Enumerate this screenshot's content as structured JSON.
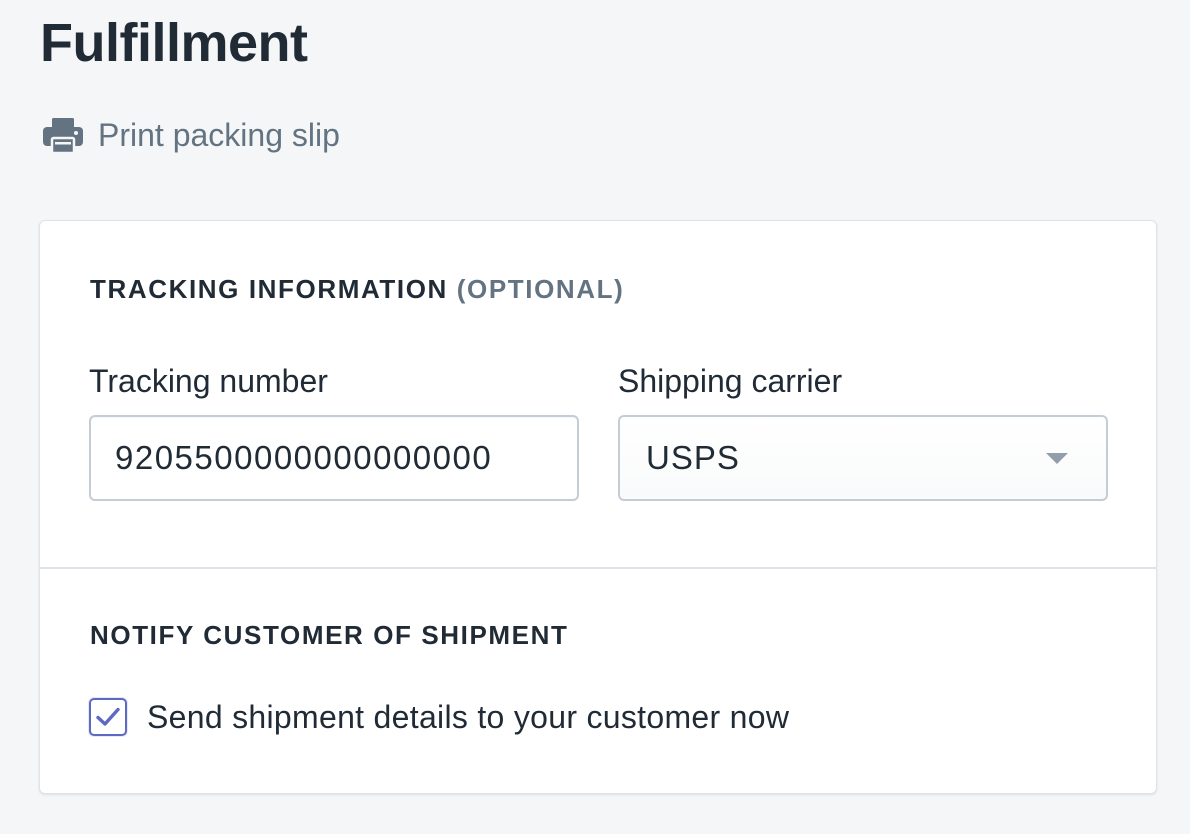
{
  "header": {
    "title": "Fulfillment",
    "print_label": "Print packing slip",
    "print_icon": "printer-icon"
  },
  "tracking": {
    "heading": "TRACKING INFORMATION",
    "heading_optional": "(OPTIONAL)",
    "number_label": "Tracking number",
    "number_value": "9205500000000000000",
    "carrier_label": "Shipping carrier",
    "carrier_value": "USPS"
  },
  "notify": {
    "heading": "NOTIFY CUSTOMER OF SHIPMENT",
    "checkbox_label": "Send shipment details to your customer now",
    "checked": true
  },
  "colors": {
    "accent": "#5c6ac4",
    "text": "#212b36",
    "subdued": "#637381",
    "background": "#f4f6f8"
  }
}
